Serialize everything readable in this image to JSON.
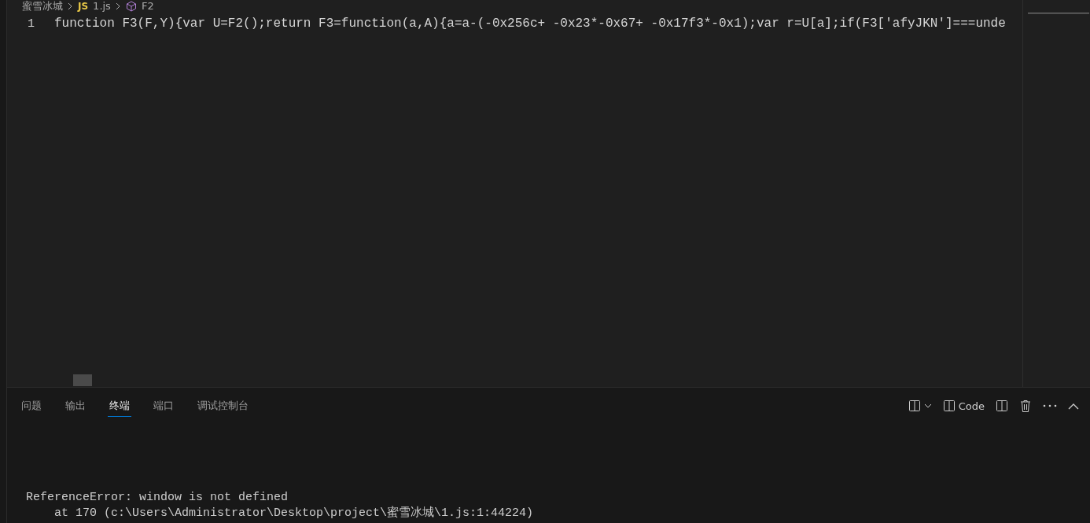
{
  "breadcrumb": [
    {
      "kind": "folder",
      "label": "蜜雪冰城"
    },
    {
      "kind": "file",
      "badge": "JS",
      "label": "1.js"
    },
    {
      "kind": "symbol",
      "label": "F2"
    }
  ],
  "editor": {
    "lines": [
      {
        "number": "1",
        "code": "function F3(F,Y){var U=F2();return F3=function(a,A){a=a-(-0x256c+ -0x23*-0x67+ -0x17f3*-0x1);var r=U[a];if(F3['afyJKN']===unde"
      }
    ]
  },
  "panel": {
    "tabs": [
      {
        "label": "问题",
        "selected": false
      },
      {
        "label": "输出",
        "selected": false
      },
      {
        "label": "终端",
        "selected": true
      },
      {
        "label": "端口",
        "selected": false
      },
      {
        "label": "调试控制台",
        "selected": false
      }
    ],
    "terminal_name": "Code",
    "output": [
      "ReferenceError: window is not defined",
      "    at 170 (c:\\Users\\Administrator\\Desktop\\project\\蜜雪冰城\\1.js:1:44224)"
    ]
  }
}
